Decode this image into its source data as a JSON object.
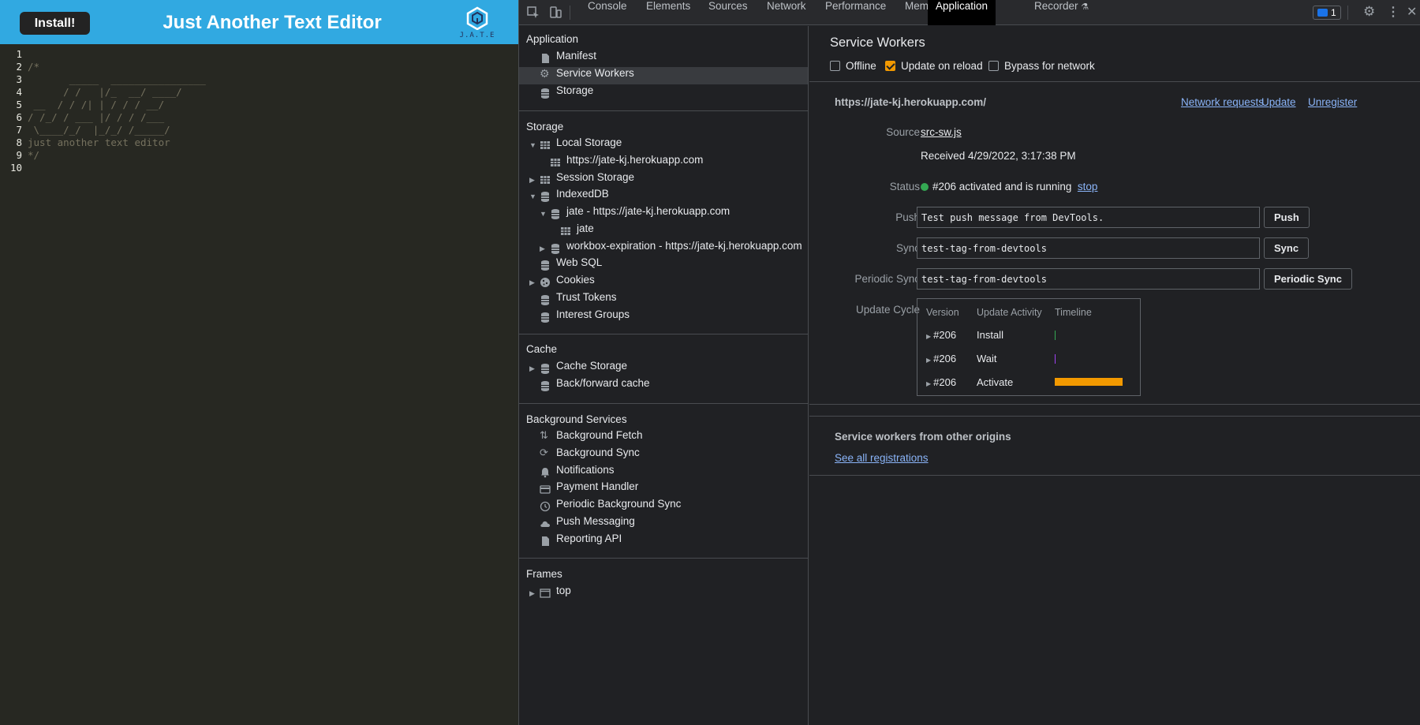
{
  "app": {
    "install_label": "Install!",
    "title": "Just Another Text Editor",
    "logo_text": "J.A.T.E",
    "editor_lines": [
      {
        "num": "1",
        "text": ""
      },
      {
        "num": "2",
        "text": "/*"
      },
      {
        "num": "3",
        "text": "       _____  ________________"
      },
      {
        "num": "4",
        "text": "      / /   |/_  __/ ____/"
      },
      {
        "num": "5",
        "text": " __  / / /| | / / / __/"
      },
      {
        "num": "6",
        "text": "/ /_/ / ___ |/ / / /___"
      },
      {
        "num": "7",
        "text": " \\____/_/  |_/_/ /_____/"
      },
      {
        "num": "8",
        "text": "just another text editor"
      },
      {
        "num": "9",
        "text": "*/"
      },
      {
        "num": "10",
        "text": ""
      }
    ]
  },
  "devtools": {
    "tabs": [
      "Console",
      "Elements",
      "Sources",
      "Network",
      "Performance",
      "Memory",
      "Application",
      "Recorder"
    ],
    "active_tab": "Application",
    "issues_count": "1",
    "sidebar": {
      "application_title": "Application",
      "application_items": [
        "Manifest",
        "Service Workers",
        "Storage"
      ],
      "storage_title": "Storage",
      "local_storage": "Local Storage",
      "local_storage_origin": "https://jate-kj.herokuapp.com",
      "session_storage": "Session Storage",
      "indexeddb": "IndexedDB",
      "idb_jate": "jate - https://jate-kj.herokuapp.com",
      "idb_jate_store": "jate",
      "idb_workbox": "workbox-expiration - https://jate-kj.herokuapp.com",
      "web_sql": "Web SQL",
      "cookies": "Cookies",
      "trust_tokens": "Trust Tokens",
      "interest_groups": "Interest Groups",
      "cache_title": "Cache",
      "cache_storage": "Cache Storage",
      "bf_cache": "Back/forward cache",
      "bg_title": "Background Services",
      "bg_items": [
        "Background Fetch",
        "Background Sync",
        "Notifications",
        "Payment Handler",
        "Periodic Background Sync",
        "Push Messaging",
        "Reporting API"
      ],
      "frames_title": "Frames",
      "frames_top": "top"
    },
    "sw": {
      "title": "Service Workers",
      "offline": "Offline",
      "update_on_reload": "Update on reload",
      "bypass": "Bypass for network",
      "origin": "https://jate-kj.herokuapp.com/",
      "network_requests": "Network requests",
      "update": "Update",
      "unregister": "Unregister",
      "source_label": "Source",
      "source_file": "src-sw.js",
      "received": "Received 4/29/2022, 3:17:38 PM",
      "status_label": "Status",
      "status_text": "#206 activated and is running",
      "stop": "stop",
      "push_label": "Push",
      "push_value": "Test push message from DevTools.",
      "push_btn": "Push",
      "sync_label": "Sync",
      "sync_value": "test-tag-from-devtools",
      "sync_btn": "Sync",
      "periodic_label": "Periodic Sync",
      "periodic_value": "test-tag-from-devtools",
      "periodic_btn": "Periodic Sync",
      "cycle_label": "Update Cycle",
      "cycle_headers": [
        "Version",
        "Update Activity",
        "Timeline"
      ],
      "cycle_rows": [
        {
          "version": "#206",
          "activity": "Install"
        },
        {
          "version": "#206",
          "activity": "Wait"
        },
        {
          "version": "#206",
          "activity": "Activate"
        }
      ],
      "other_origins_title": "Service workers from other origins",
      "see_all": "See all registrations"
    },
    "colors": {
      "accent_orange": "#f29900",
      "status_green": "#34a853",
      "link_blue": "#8ab4f8",
      "header_blue": "#31a9e1"
    }
  }
}
